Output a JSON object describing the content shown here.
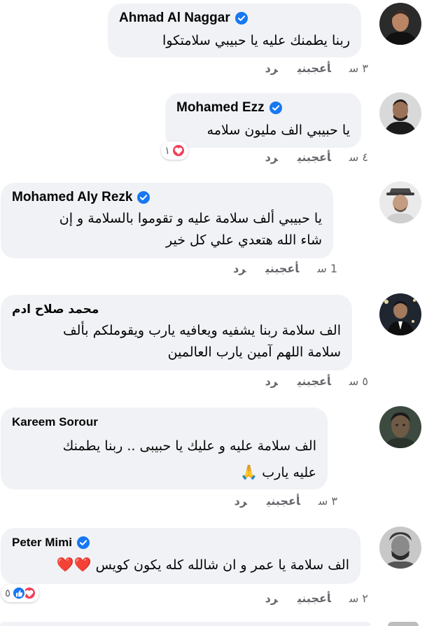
{
  "comments": [
    {
      "name": "Ahmad Al Naggar",
      "verified": true,
      "lines": [
        "ربنا يطمنك عليه يا حبيبي سلامتكوا"
      ],
      "time": "٣ س",
      "like": "أعجبني",
      "reply": "رد"
    },
    {
      "name": "Mohamed Ezz",
      "verified": true,
      "lines": [
        "يا حبيبي الف مليون سلامه"
      ],
      "time": "٤ س",
      "like": "أعجبني",
      "reply": "رد",
      "reactions": {
        "count": "١",
        "types": [
          "love"
        ]
      }
    },
    {
      "name": "Mohamed Aly Rezk",
      "verified": true,
      "lines": [
        "يا حبيبي ألف سلامة عليه و تقوموا بالسلامة و إن",
        "شاء الله هتعدي علي كل خير"
      ],
      "time": "1 س",
      "like": "أعجبني",
      "reply": "رد"
    },
    {
      "name": "محمد صلاح ادم",
      "verified": false,
      "lines": [
        "الف سلامة ربنا يشفيه ويعافيه يارب ويقوملكم بألف",
        "سلامة اللهم آمين يارب العالمين"
      ],
      "time": "٥ س",
      "like": "أعجبني",
      "reply": "رد"
    },
    {
      "name": "Kareem Sorour",
      "verified": false,
      "lines": [
        "الف سلامة عليه و عليك يا حبيبى .. ربنا يطمنك",
        "عليه يارب"
      ],
      "emoji2": "🙏",
      "time": "٣ س",
      "like": "أعجبني",
      "reply": "رد"
    },
    {
      "name": "Peter Mimi",
      "verified": true,
      "lines": [
        "الف سلامة يا عمر و ان شالله كله يكون كويس"
      ],
      "emoji1": "❤️❤️",
      "time": "٢ س",
      "like": "أعجبني",
      "reply": "رد",
      "reactions": {
        "count": "٥",
        "types": [
          "like",
          "love"
        ]
      }
    }
  ],
  "colors": {
    "bubble": "#f0f2f5",
    "verified": "#1877f2",
    "meta": "#65676b",
    "love": "#f33e58",
    "like": "#1877f2"
  },
  "icons": {
    "verified": "verified-badge-icon",
    "love": "heart-reaction-icon",
    "like": "thumbs-up-reaction-icon"
  }
}
